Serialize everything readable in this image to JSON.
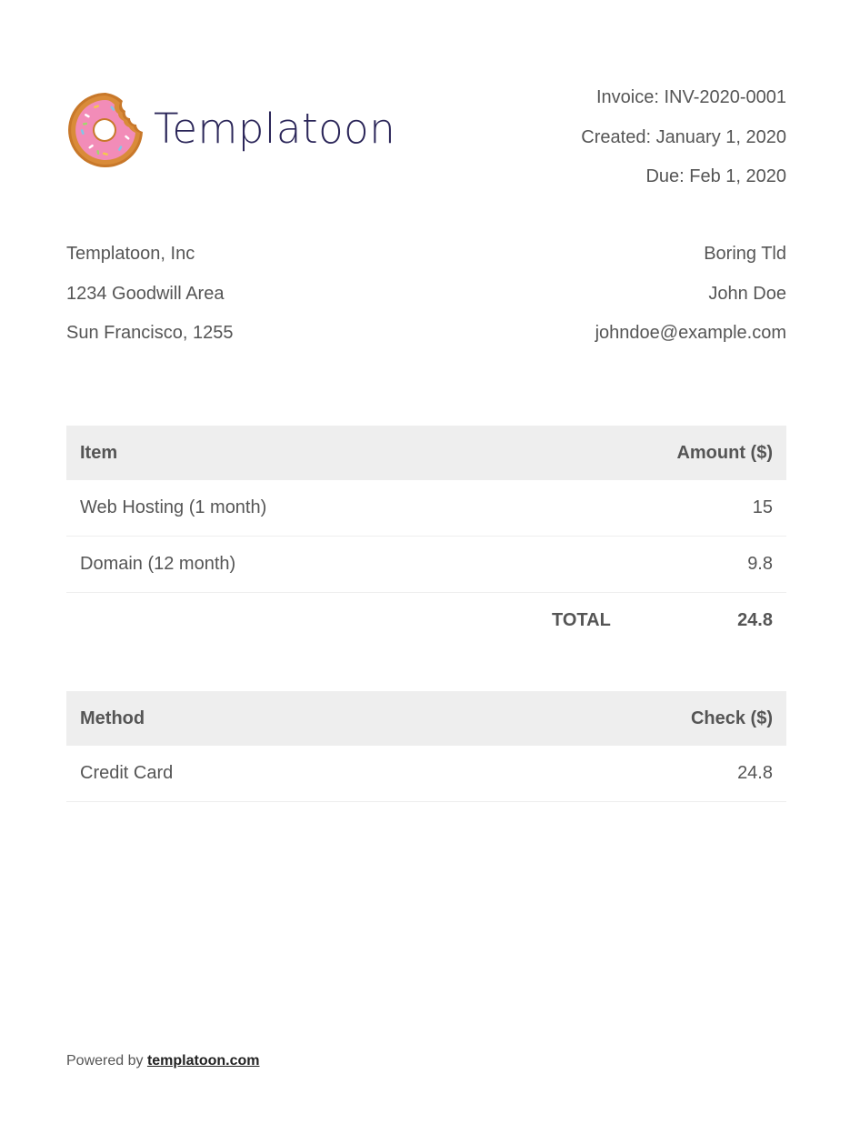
{
  "header": {
    "brand": "Templatoon",
    "invoice": "Invoice: INV-2020-0001",
    "created": "Created: January 1, 2020",
    "due": "Due: Feb 1, 2020"
  },
  "from": {
    "company": "Templatoon, Inc",
    "address": "1234 Goodwill Area",
    "city": "Sun Francisco, 1255"
  },
  "to": {
    "company": "Boring Tld",
    "name": "John Doe",
    "email": "johndoe@example.com"
  },
  "items_table": {
    "headers": [
      "Item",
      "Amount ($)"
    ],
    "rows": [
      {
        "item": "Web Hosting (1 month)",
        "amount": "15"
      },
      {
        "item": "Domain (12 month)",
        "amount": "9.8"
      }
    ],
    "total_label": "TOTAL",
    "total_value": "24.8"
  },
  "payment_table": {
    "headers": [
      "Method",
      "Check ($)"
    ],
    "rows": [
      {
        "method": "Credit Card",
        "check": "24.8"
      }
    ]
  },
  "footer": {
    "prefix": "Powered by ",
    "link_text": "templatoon.com"
  },
  "icons": {
    "logo": "donut-icon"
  },
  "colors": {
    "brand_text": "#2b2659",
    "table_header_bg": "#eeeeee",
    "text": "#555555"
  }
}
